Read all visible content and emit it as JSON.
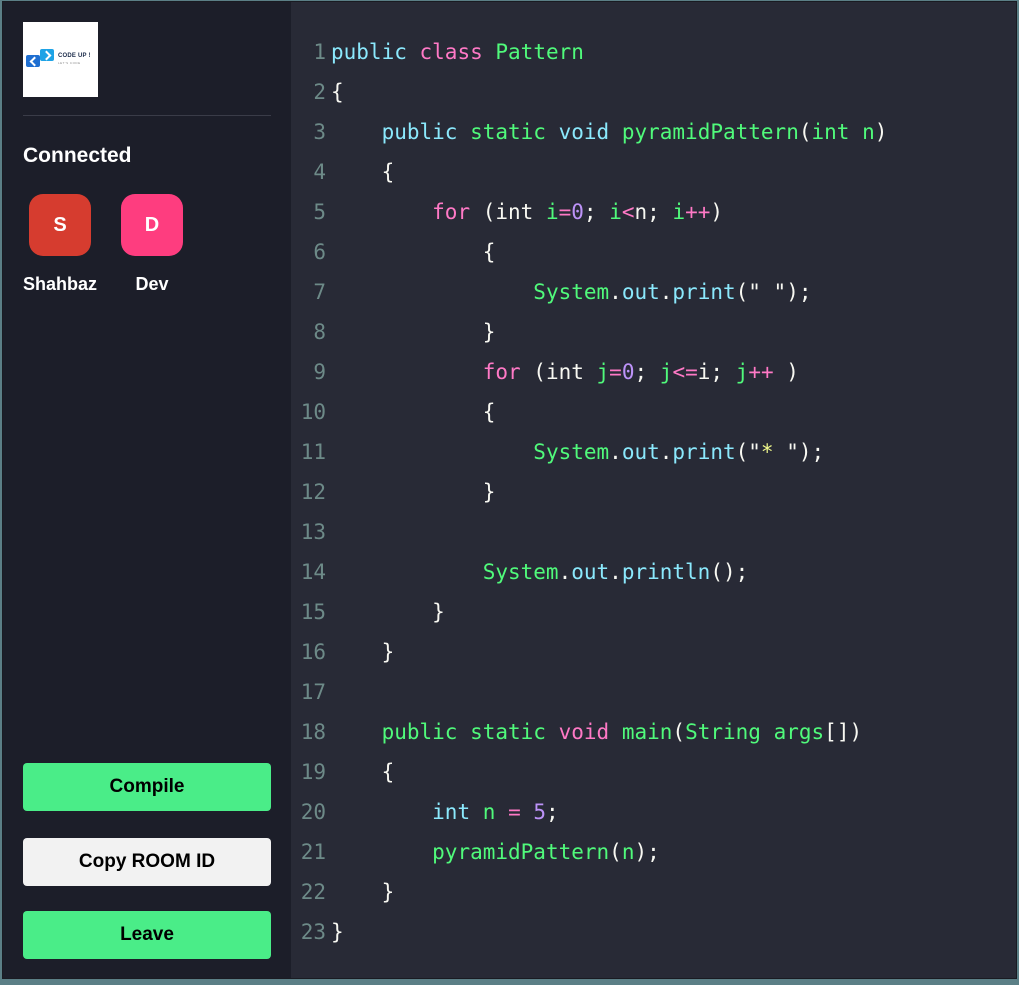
{
  "logo": {
    "title": "CODE UP !",
    "subtitle": "LET'S CODE"
  },
  "sidebar": {
    "heading": "Connected",
    "clients": [
      {
        "initial": "S",
        "name": "Shahbaz",
        "color": "#d63c2f"
      },
      {
        "initial": "D",
        "name": "Dev",
        "color": "#fe3d7f"
      }
    ],
    "buttons": {
      "compile": "Compile",
      "copy_room_id": "Copy ROOM ID",
      "leave": "Leave"
    }
  },
  "editor": {
    "language": "java",
    "lines": [
      [
        [
          "kw-cls",
          "public"
        ],
        [
          "p",
          " "
        ],
        [
          "kw",
          "class"
        ],
        [
          "p",
          " "
        ],
        [
          "cls",
          "Pattern"
        ]
      ],
      [
        [
          "p",
          "{"
        ]
      ],
      [
        [
          "p",
          "    "
        ],
        [
          "type",
          "public"
        ],
        [
          "p",
          " "
        ],
        [
          "cls",
          "static"
        ],
        [
          "p",
          " "
        ],
        [
          "type",
          "void"
        ],
        [
          "p",
          " "
        ],
        [
          "fn",
          "pyramidPattern"
        ],
        [
          "p",
          "("
        ],
        [
          "cls",
          "int"
        ],
        [
          "p",
          " "
        ],
        [
          "var",
          "n"
        ],
        [
          "p",
          ")"
        ]
      ],
      [
        [
          "p",
          "    {"
        ]
      ],
      [
        [
          "p",
          "        "
        ],
        [
          "kw",
          "for"
        ],
        [
          "p",
          " (int "
        ],
        [
          "var",
          "i"
        ],
        [
          "op",
          "="
        ],
        [
          "num",
          "0"
        ],
        [
          "p",
          "; "
        ],
        [
          "var",
          "i"
        ],
        [
          "op",
          "<"
        ],
        [
          "p",
          "n; "
        ],
        [
          "var",
          "i"
        ],
        [
          "op",
          "++"
        ],
        [
          "p",
          ")"
        ]
      ],
      [
        [
          "p",
          "            {"
        ]
      ],
      [
        [
          "p",
          "                "
        ],
        [
          "fn",
          "System"
        ],
        [
          "p",
          "."
        ],
        [
          "prop",
          "out"
        ],
        [
          "p",
          "."
        ],
        [
          "prop",
          "print"
        ],
        [
          "p",
          "(\" \");"
        ]
      ],
      [
        [
          "p",
          "            }"
        ]
      ],
      [
        [
          "p",
          "            "
        ],
        [
          "kw",
          "for"
        ],
        [
          "p",
          " (int "
        ],
        [
          "var",
          "j"
        ],
        [
          "op",
          "="
        ],
        [
          "num",
          "0"
        ],
        [
          "p",
          "; "
        ],
        [
          "var",
          "j"
        ],
        [
          "op",
          "<="
        ],
        [
          "p",
          "i; "
        ],
        [
          "var",
          "j"
        ],
        [
          "op",
          "++"
        ],
        [
          "p",
          " )"
        ]
      ],
      [
        [
          "p",
          "            {"
        ]
      ],
      [
        [
          "p",
          "                "
        ],
        [
          "fn",
          "System"
        ],
        [
          "p",
          "."
        ],
        [
          "prop",
          "out"
        ],
        [
          "p",
          "."
        ],
        [
          "prop",
          "print"
        ],
        [
          "p",
          "(\""
        ],
        [
          "str",
          "*"
        ],
        [
          "p",
          " \");"
        ]
      ],
      [
        [
          "p",
          "            }"
        ]
      ],
      [
        [
          "p",
          ""
        ]
      ],
      [
        [
          "p",
          "            "
        ],
        [
          "fn",
          "System"
        ],
        [
          "p",
          "."
        ],
        [
          "prop",
          "out"
        ],
        [
          "p",
          "."
        ],
        [
          "prop",
          "println"
        ],
        [
          "p",
          "();"
        ]
      ],
      [
        [
          "p",
          "        }"
        ]
      ],
      [
        [
          "p",
          "    }"
        ]
      ],
      [
        [
          "p",
          ""
        ]
      ],
      [
        [
          "p",
          "    "
        ],
        [
          "cls",
          "public"
        ],
        [
          "p",
          " "
        ],
        [
          "cls",
          "static"
        ],
        [
          "p",
          " "
        ],
        [
          "kw",
          "void"
        ],
        [
          "p",
          " "
        ],
        [
          "fn",
          "main"
        ],
        [
          "p",
          "("
        ],
        [
          "cls",
          "String"
        ],
        [
          "p",
          " "
        ],
        [
          "var",
          "args"
        ],
        [
          "p",
          "[])"
        ]
      ],
      [
        [
          "p",
          "    {"
        ]
      ],
      [
        [
          "p",
          "        "
        ],
        [
          "type",
          "int"
        ],
        [
          "p",
          " "
        ],
        [
          "var",
          "n"
        ],
        [
          "p",
          " "
        ],
        [
          "op",
          "="
        ],
        [
          "p",
          " "
        ],
        [
          "num",
          "5"
        ],
        [
          "p",
          ";"
        ]
      ],
      [
        [
          "p",
          "        "
        ],
        [
          "fn",
          "pyramidPattern"
        ],
        [
          "p",
          "("
        ],
        [
          "var",
          "n"
        ],
        [
          "p",
          ");"
        ]
      ],
      [
        [
          "p",
          "    }"
        ]
      ],
      [
        [
          "p",
          "}"
        ]
      ]
    ]
  }
}
